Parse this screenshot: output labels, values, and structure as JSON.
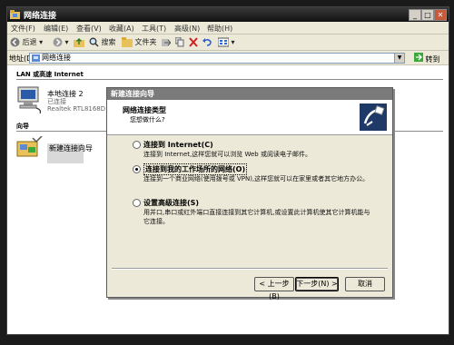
{
  "window": {
    "title": "网络连接"
  },
  "menu": [
    "文件(F)",
    "编辑(E)",
    "查看(V)",
    "收藏(A)",
    "工具(T)",
    "高级(N)",
    "帮助(H)"
  ],
  "toolbar": {
    "back": "后退",
    "search": "搜索",
    "folders": "文件夹"
  },
  "address": {
    "label": "地址(D)",
    "value": "网络连接",
    "go": "转到"
  },
  "content": {
    "group_lan": "LAN 或高速 Internet",
    "connection": {
      "name": "本地连接 2",
      "status": "已连接",
      "device": "Realtek RTL8168D..."
    },
    "group_wizard": "向导",
    "wizard_item": "新建连接向导"
  },
  "dialog": {
    "title": "新建连接向导",
    "header_title": "网络连接类型",
    "header_subtitle": "您想做什么?",
    "options": [
      {
        "label": "连接到 Internet(C)",
        "desc": "连接到 Internet,这样您就可以浏览 Web 或阅读电子邮件。",
        "selected": false
      },
      {
        "label": "连接到我的工作场所的网络(O)",
        "desc": "连接到一个商业网络(使用拨号或 VPN),这样您就可以在家里或者其它地方办公。",
        "selected": true
      },
      {
        "label": "设置高级连接(S)",
        "desc": "用并口,串口或红外端口直接连接到其它计算机,或设置此计算机使其它计算机能与它连接。",
        "selected": false
      }
    ],
    "buttons": {
      "back": "< 上一步(B)",
      "next": "下一步(N) >",
      "cancel": "取消"
    }
  }
}
